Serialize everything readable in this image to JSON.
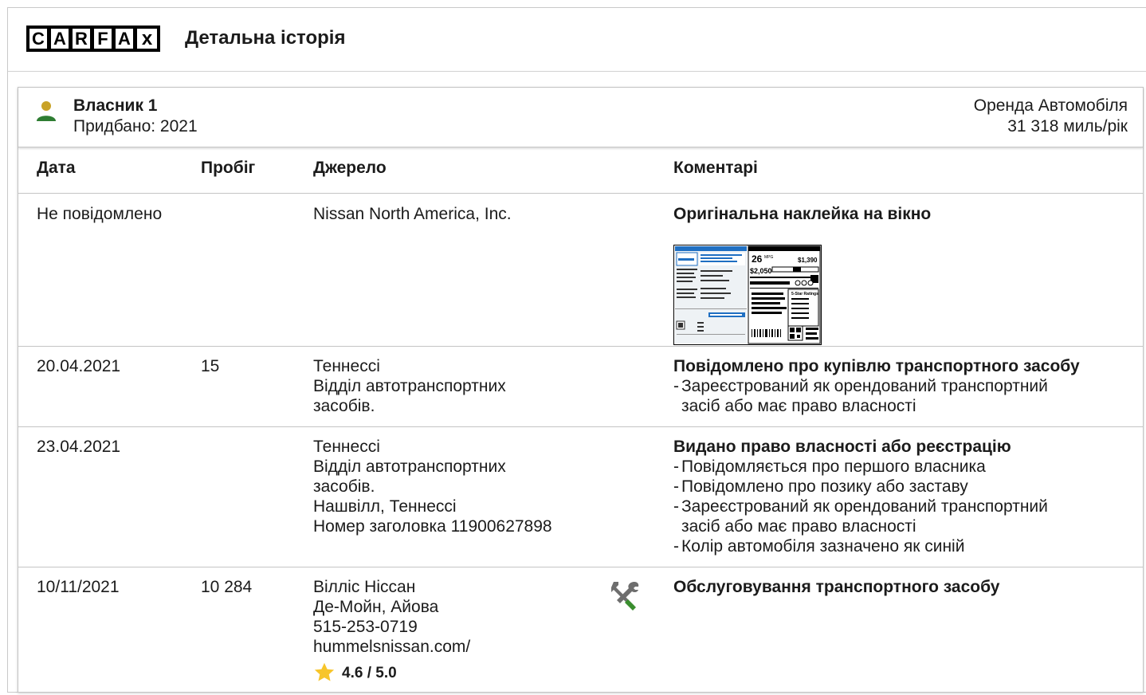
{
  "header": {
    "logo_letters": [
      "C",
      "A",
      "R",
      "F",
      "A",
      "x"
    ],
    "title": "Детальна історія"
  },
  "owner": {
    "name": "Власник 1",
    "purchased": "Придбано: 2021",
    "type": "Оренда Автомобіля",
    "miles_per_year": "31 318 миль/рік",
    "icon": "person-icon",
    "icon_colors": {
      "head": "#c9a227",
      "body": "#2e7d32"
    }
  },
  "columns": {
    "date": "Дата",
    "mileage": "Пробіг",
    "source": "Джерело",
    "comments": "Коментарі"
  },
  "records": [
    {
      "date": "Не повідомлено",
      "mileage": "",
      "source": [
        "Nissan North America, Inc."
      ],
      "comment_title": "Оригінальна наклейка на вікно",
      "comment_items": [],
      "has_sticker": true
    },
    {
      "date": "20.04.2021",
      "mileage": "15",
      "source": [
        "Теннессі",
        "Відділ автотранспортних",
        "засобів."
      ],
      "comment_title": "Повідомлено про купівлю транспортного засобу",
      "comment_items": [
        [
          "Зареєстрований як орендований транспортний",
          "засіб або має право власності"
        ]
      ]
    },
    {
      "date": "23.04.2021",
      "mileage": "",
      "source": [
        "Теннессі",
        "Відділ автотранспортних",
        "засобів.",
        "Нашвілл, Теннессі",
        "Номер заголовка 11900627898"
      ],
      "comment_title": "Видано право власності або реєстрацію",
      "comment_items": [
        [
          "Повідомляється про першого власника"
        ],
        [
          "Повідомлено про позику або заставу"
        ],
        [
          "Зареєстрований як орендований транспортний",
          "засіб або має право власності"
        ],
        [
          "Колір автомобіля зазначено як синій"
        ]
      ]
    },
    {
      "date": "10/11/2021",
      "mileage": "10 284",
      "source": [
        "Вілліс Ніссан",
        "Де-Мойн, Айова",
        "515-253-0719",
        "hummelsnissan.com/"
      ],
      "rating": "4.6 / 5.0",
      "service_icon": "wrench-screwdriver-icon",
      "comment_title": "Обслуговування транспортного засобу",
      "comment_items": []
    }
  ],
  "sticker": {
    "mpg": "26",
    "mpg_unit": "MPG",
    "fuel_cost": "$2,050",
    "price": "$1,390",
    "rating_label": "5-Star Ratings"
  },
  "colors": {
    "accent_blue": "#1f6fc2",
    "star": "#f7c52a",
    "wrench_grey": "#6e6e6e",
    "screwdriver_green": "#3a8e2e"
  }
}
